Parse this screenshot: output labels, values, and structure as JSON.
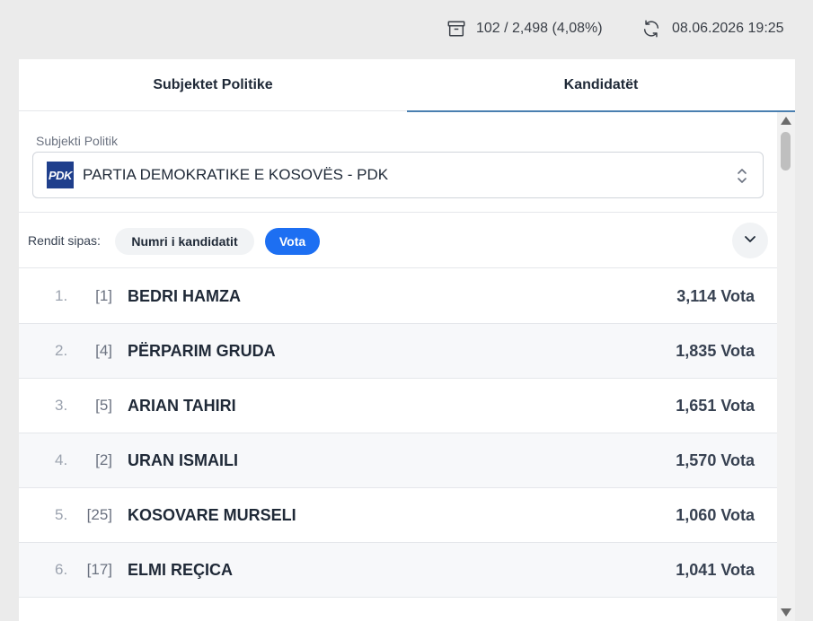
{
  "header": {
    "count_text": "102 / 2,498 (4,08%)",
    "count_icon": "archive-box-icon",
    "datetime_text": "08.06.2026 19:25",
    "refresh_icon": "refresh-icon"
  },
  "tabs": [
    {
      "label": "Subjektet Politike",
      "active": false
    },
    {
      "label": "Kandidatët",
      "active": true
    }
  ],
  "party_field": {
    "label": "Subjekti Politik",
    "logo_text": "PDK",
    "selected": "PARTIA DEMOKRATIKE E KOSOVËS - PDK"
  },
  "sort": {
    "label": "Rendit sipas:",
    "options": [
      {
        "label": "Numri i kandidatit",
        "active": false
      },
      {
        "label": "Vota",
        "active": true
      }
    ]
  },
  "candidates": [
    {
      "rank": "1.",
      "number": "[1]",
      "name": "BEDRI HAMZA",
      "votes": "3,114 Vota"
    },
    {
      "rank": "2.",
      "number": "[4]",
      "name": "PËRPARIM GRUDA",
      "votes": "1,835 Vota"
    },
    {
      "rank": "3.",
      "number": "[5]",
      "name": "ARIAN TAHIRI",
      "votes": "1,651 Vota"
    },
    {
      "rank": "4.",
      "number": "[2]",
      "name": "URAN ISMAILI",
      "votes": "1,570 Vota"
    },
    {
      "rank": "5.",
      "number": "[25]",
      "name": "KOSOVARE MURSELI",
      "votes": "1,060 Vota"
    },
    {
      "rank": "6.",
      "number": "[17]",
      "name": "ELMI REÇICA",
      "votes": "1,041 Vota"
    }
  ],
  "colors": {
    "accent": "#1d6ff2",
    "tab_underline": "#4a7fb0",
    "logo_bg": "#1f3f8c"
  }
}
